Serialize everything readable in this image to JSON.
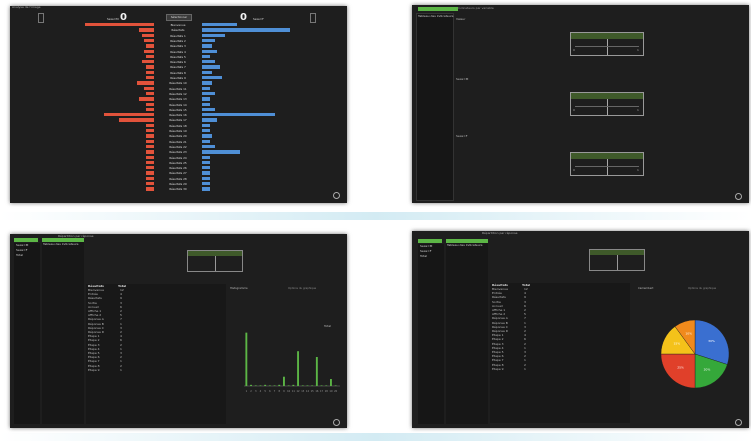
{
  "p1": {
    "title": "Analyse de l'image",
    "left_count": "0",
    "right_count": "0",
    "left_label": "Sexe=M",
    "right_label": "Sexe=F",
    "center_button": "Sélectionner",
    "rows": [
      {
        "label": "Bienvenue",
        "lv": 0.55,
        "rv": 0.28
      },
      {
        "label": "Résultats",
        "lv": 0.12,
        "rv": 0.7
      },
      {
        "label": "Résultats 1",
        "lv": 0.1,
        "rv": 0.18
      },
      {
        "label": "Résultats 2",
        "lv": 0.08,
        "rv": 0.1
      },
      {
        "label": "Résultats 3",
        "lv": 0.06,
        "rv": 0.08
      },
      {
        "label": "Résultats 4",
        "lv": 0.08,
        "rv": 0.12
      },
      {
        "label": "Résultats 5",
        "lv": 0.06,
        "rv": 0.06
      },
      {
        "label": "Résultats 6",
        "lv": 0.1,
        "rv": 0.1
      },
      {
        "label": "Résultats 7",
        "lv": 0.05,
        "rv": 0.14
      },
      {
        "label": "Résultats 8",
        "lv": 0.06,
        "rv": 0.08
      },
      {
        "label": "Résultats 9",
        "lv": 0.04,
        "rv": 0.16
      },
      {
        "label": "Résultats 10",
        "lv": 0.14,
        "rv": 0.08
      },
      {
        "label": "Résultats 11",
        "lv": 0.08,
        "rv": 0.06
      },
      {
        "label": "Résultats 12",
        "lv": 0.06,
        "rv": 0.1
      },
      {
        "label": "Résultats 13",
        "lv": 0.12,
        "rv": 0.05
      },
      {
        "label": "Résultats 14",
        "lv": 0.06,
        "rv": 0.06
      },
      {
        "label": "Résultats 15",
        "lv": 0.05,
        "rv": 0.1
      },
      {
        "label": "Résultats 16",
        "lv": 0.4,
        "rv": 0.58
      },
      {
        "label": "Résultats 17",
        "lv": 0.28,
        "rv": 0.12
      },
      {
        "label": "Résultats 18",
        "lv": 0.04,
        "rv": 0.06
      },
      {
        "label": "Résultats 19",
        "lv": 0.05,
        "rv": 0.05
      },
      {
        "label": "Résultats 20",
        "lv": 0.06,
        "rv": 0.08
      },
      {
        "label": "Résultats 21",
        "lv": 0.04,
        "rv": 0.06
      },
      {
        "label": "Résultats 22",
        "lv": 0.06,
        "rv": 0.1
      },
      {
        "label": "Résultats 23",
        "lv": 0.04,
        "rv": 0.3
      },
      {
        "label": "Résultats 24",
        "lv": 0.05,
        "rv": 0.06
      },
      {
        "label": "Résultats 25",
        "lv": 0.03,
        "rv": 0.04
      },
      {
        "label": "Résultats 26",
        "lv": 0.04,
        "rv": 0.05
      },
      {
        "label": "Résultats 27",
        "lv": 0.03,
        "rv": 0.04
      },
      {
        "label": "Résultats 28",
        "lv": 0.03,
        "rv": 0.03
      },
      {
        "label": "Résultats 29",
        "lv": 0.02,
        "rv": 0.03
      },
      {
        "label": "Résultats 30",
        "lv": 0.02,
        "rv": 0.02
      }
    ]
  },
  "p2": {
    "tab": "Tableau des Indicateurs",
    "sidebar_items": [
      "Tableau des Indicateurs"
    ],
    "header": "Indicateurs par variable",
    "row_labels": [
      "Valeur",
      "Sexe=M",
      "Sexe=F"
    ],
    "box_tick_left": "0",
    "box_tick_right": "1"
  },
  "p3": {
    "title": "Répartition par réponse",
    "tab": "Tableau des Indicateurs",
    "sidebar_items": [
      "Sexe=M",
      "Sexe=F",
      "Total"
    ],
    "table_headers": [
      "Résultats",
      "Total"
    ],
    "table_rows": [
      [
        "Bienvenue",
        "12"
      ],
      [
        "Entrée",
        "4"
      ],
      [
        "Résultats",
        "9"
      ],
      [
        "Sortie",
        "3"
      ],
      [
        "Accueil",
        "6"
      ],
      [
        "Affiche 1",
        "2"
      ],
      [
        "Affiche 2",
        "5"
      ],
      [
        "Réponse A",
        "7"
      ],
      [
        "Réponse B",
        "1"
      ],
      [
        "Réponse C",
        "3"
      ],
      [
        "Réponse D",
        "2"
      ],
      [
        "Étape 1",
        "4"
      ],
      [
        "Étape 2",
        "6"
      ],
      [
        "Étape 3",
        "2"
      ],
      [
        "Étape 4",
        "1"
      ],
      [
        "Étape 5",
        "3"
      ],
      [
        "Étape 6",
        "2"
      ],
      [
        "Étape 7",
        "1"
      ],
      [
        "Étape 8",
        "2"
      ],
      [
        "Étape 9",
        "1"
      ]
    ],
    "chart_tabs": [
      "Histogramme",
      "Options du graphique"
    ]
  },
  "p4": {
    "title": "Répartition par réponse",
    "tab": "Tableau des Indicateurs",
    "sidebar_items": [
      "Sexe=M",
      "Sexe=F",
      "Total"
    ],
    "table_headers": [
      "Résultats",
      "Total"
    ],
    "table_rows": [
      [
        "Bienvenue",
        "12"
      ],
      [
        "Entrée",
        "4"
      ],
      [
        "Résultats",
        "9"
      ],
      [
        "Sortie",
        "3"
      ],
      [
        "Accueil",
        "6"
      ],
      [
        "Affiche 1",
        "2"
      ],
      [
        "Affiche 2",
        "5"
      ],
      [
        "Réponse A",
        "7"
      ],
      [
        "Réponse B",
        "1"
      ],
      [
        "Réponse C",
        "3"
      ],
      [
        "Réponse D",
        "2"
      ],
      [
        "Étape 1",
        "4"
      ],
      [
        "Étape 2",
        "6"
      ],
      [
        "Étape 3",
        "2"
      ],
      [
        "Étape 4",
        "1"
      ],
      [
        "Étape 5",
        "3"
      ],
      [
        "Étape 6",
        "2"
      ],
      [
        "Étape 7",
        "1"
      ],
      [
        "Étape 8",
        "2"
      ],
      [
        "Étape 9",
        "1"
      ]
    ],
    "chart_tabs": [
      "Camembert",
      "Options du graphique"
    ]
  },
  "chart_data": [
    {
      "type": "bar",
      "categories": [
        "1",
        "2",
        "3",
        "4",
        "5",
        "6",
        "7",
        "8",
        "9",
        "10",
        "11",
        "12",
        "13",
        "14",
        "15",
        "16",
        "17",
        "18",
        "19",
        "20"
      ],
      "values": [
        92,
        2,
        1,
        1,
        2,
        1,
        1,
        2,
        16,
        1,
        2,
        60,
        1,
        1,
        1,
        50,
        1,
        1,
        12,
        1
      ],
      "ylim": [
        0,
        100
      ],
      "legend": [
        "Total"
      ]
    },
    {
      "type": "pie",
      "categories": [
        "A",
        "B",
        "C",
        "D",
        "E"
      ],
      "values": [
        30,
        20,
        25,
        15,
        10
      ],
      "colors": [
        "#3a6fd0",
        "#35a83a",
        "#e0402a",
        "#f4c21a",
        "#f08a1c"
      ],
      "labels": [
        "30%",
        "20%",
        "25%",
        "15%",
        "10%"
      ]
    }
  ],
  "colors": {
    "panel_bg": "#1e1e1e",
    "red_bar": "#e2533b",
    "blue_bar": "#4f8fd6",
    "green": "#5cb646",
    "dark_green": "#3f5a2a"
  }
}
